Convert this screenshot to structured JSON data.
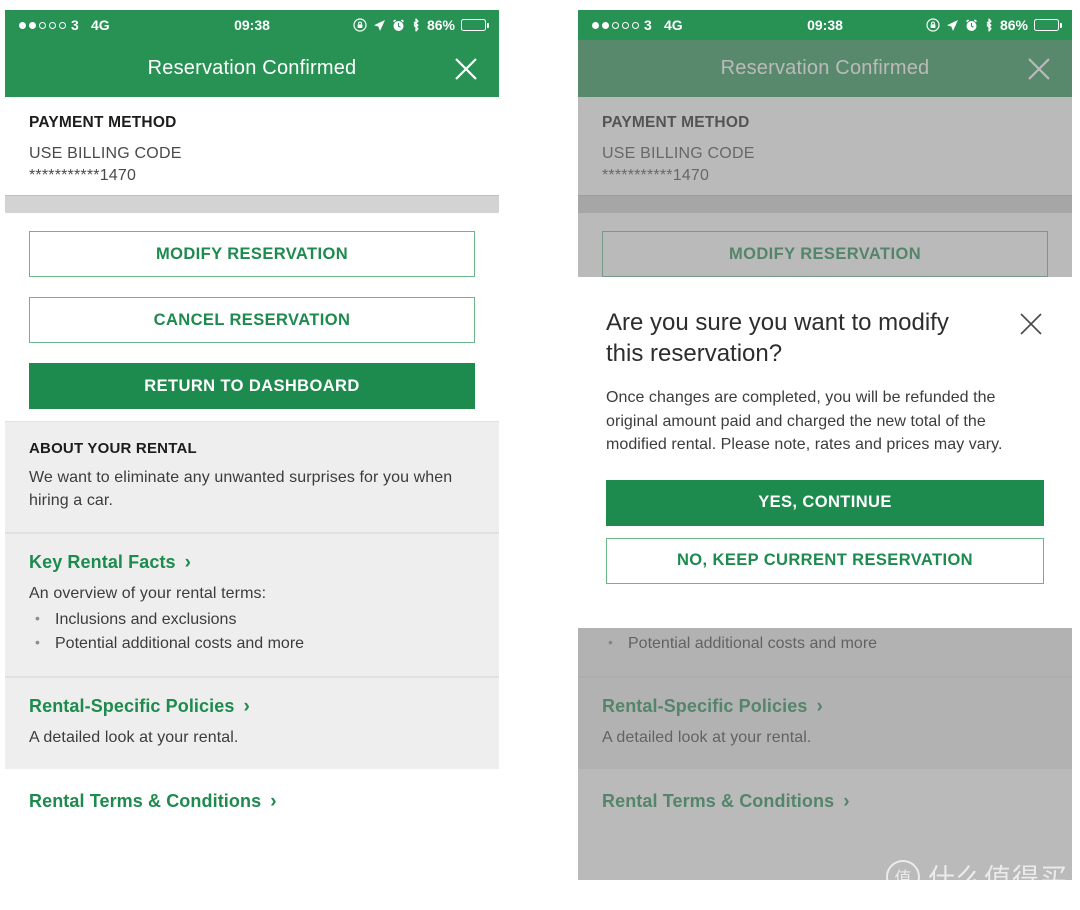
{
  "status_bar": {
    "signal_dots_filled": 2,
    "signal_dots_total": 5,
    "carrier": "3",
    "network": "4G",
    "time": "09:38",
    "battery_percent": "86%",
    "icons": [
      "lock-rotation-icon",
      "location-arrow-icon",
      "alarm-clock-icon",
      "bluetooth-icon",
      "battery-icon"
    ]
  },
  "nav": {
    "title": "Reservation Confirmed",
    "close_icon": "close-icon"
  },
  "payment": {
    "heading": "PAYMENT METHOD",
    "method": "USE BILLING CODE",
    "masked_number": "***********1470"
  },
  "actions": {
    "modify": "MODIFY RESERVATION",
    "cancel": "CANCEL RESERVATION",
    "dashboard": "RETURN TO DASHBOARD"
  },
  "about": {
    "heading": "ABOUT YOUR RENTAL",
    "text": "We want to eliminate any unwanted surprises for you when hiring a car."
  },
  "key_facts": {
    "title": "Key Rental Facts",
    "chevron": "›",
    "intro": "An overview of your rental terms:",
    "bullets": [
      "Inclusions and exclusions",
      "Potential additional costs and more"
    ]
  },
  "policies": {
    "title": "Rental-Specific Policies",
    "chevron": "›",
    "text": "A detailed look at your rental."
  },
  "terms": {
    "title": "Rental Terms & Conditions",
    "chevron": "›"
  },
  "modal": {
    "title": "Are you sure you want to modify this reservation?",
    "body": "Once changes are completed, you will be refunded the original amount paid and charged the new total of the modified rental. Please note, rates and prices may vary.",
    "confirm": "YES, CONTINUE",
    "decline": "NO, KEEP CURRENT RESERVATION",
    "close_icon": "close-icon"
  },
  "watermark": {
    "logo_char": "值",
    "text": "什么值得买"
  },
  "colors": {
    "brand_green": "#279254",
    "button_green": "#1d8a4e",
    "link_green": "#1d8a4e",
    "panel_gray": "#eeeeee",
    "divider_gray": "#d3d3d3"
  }
}
